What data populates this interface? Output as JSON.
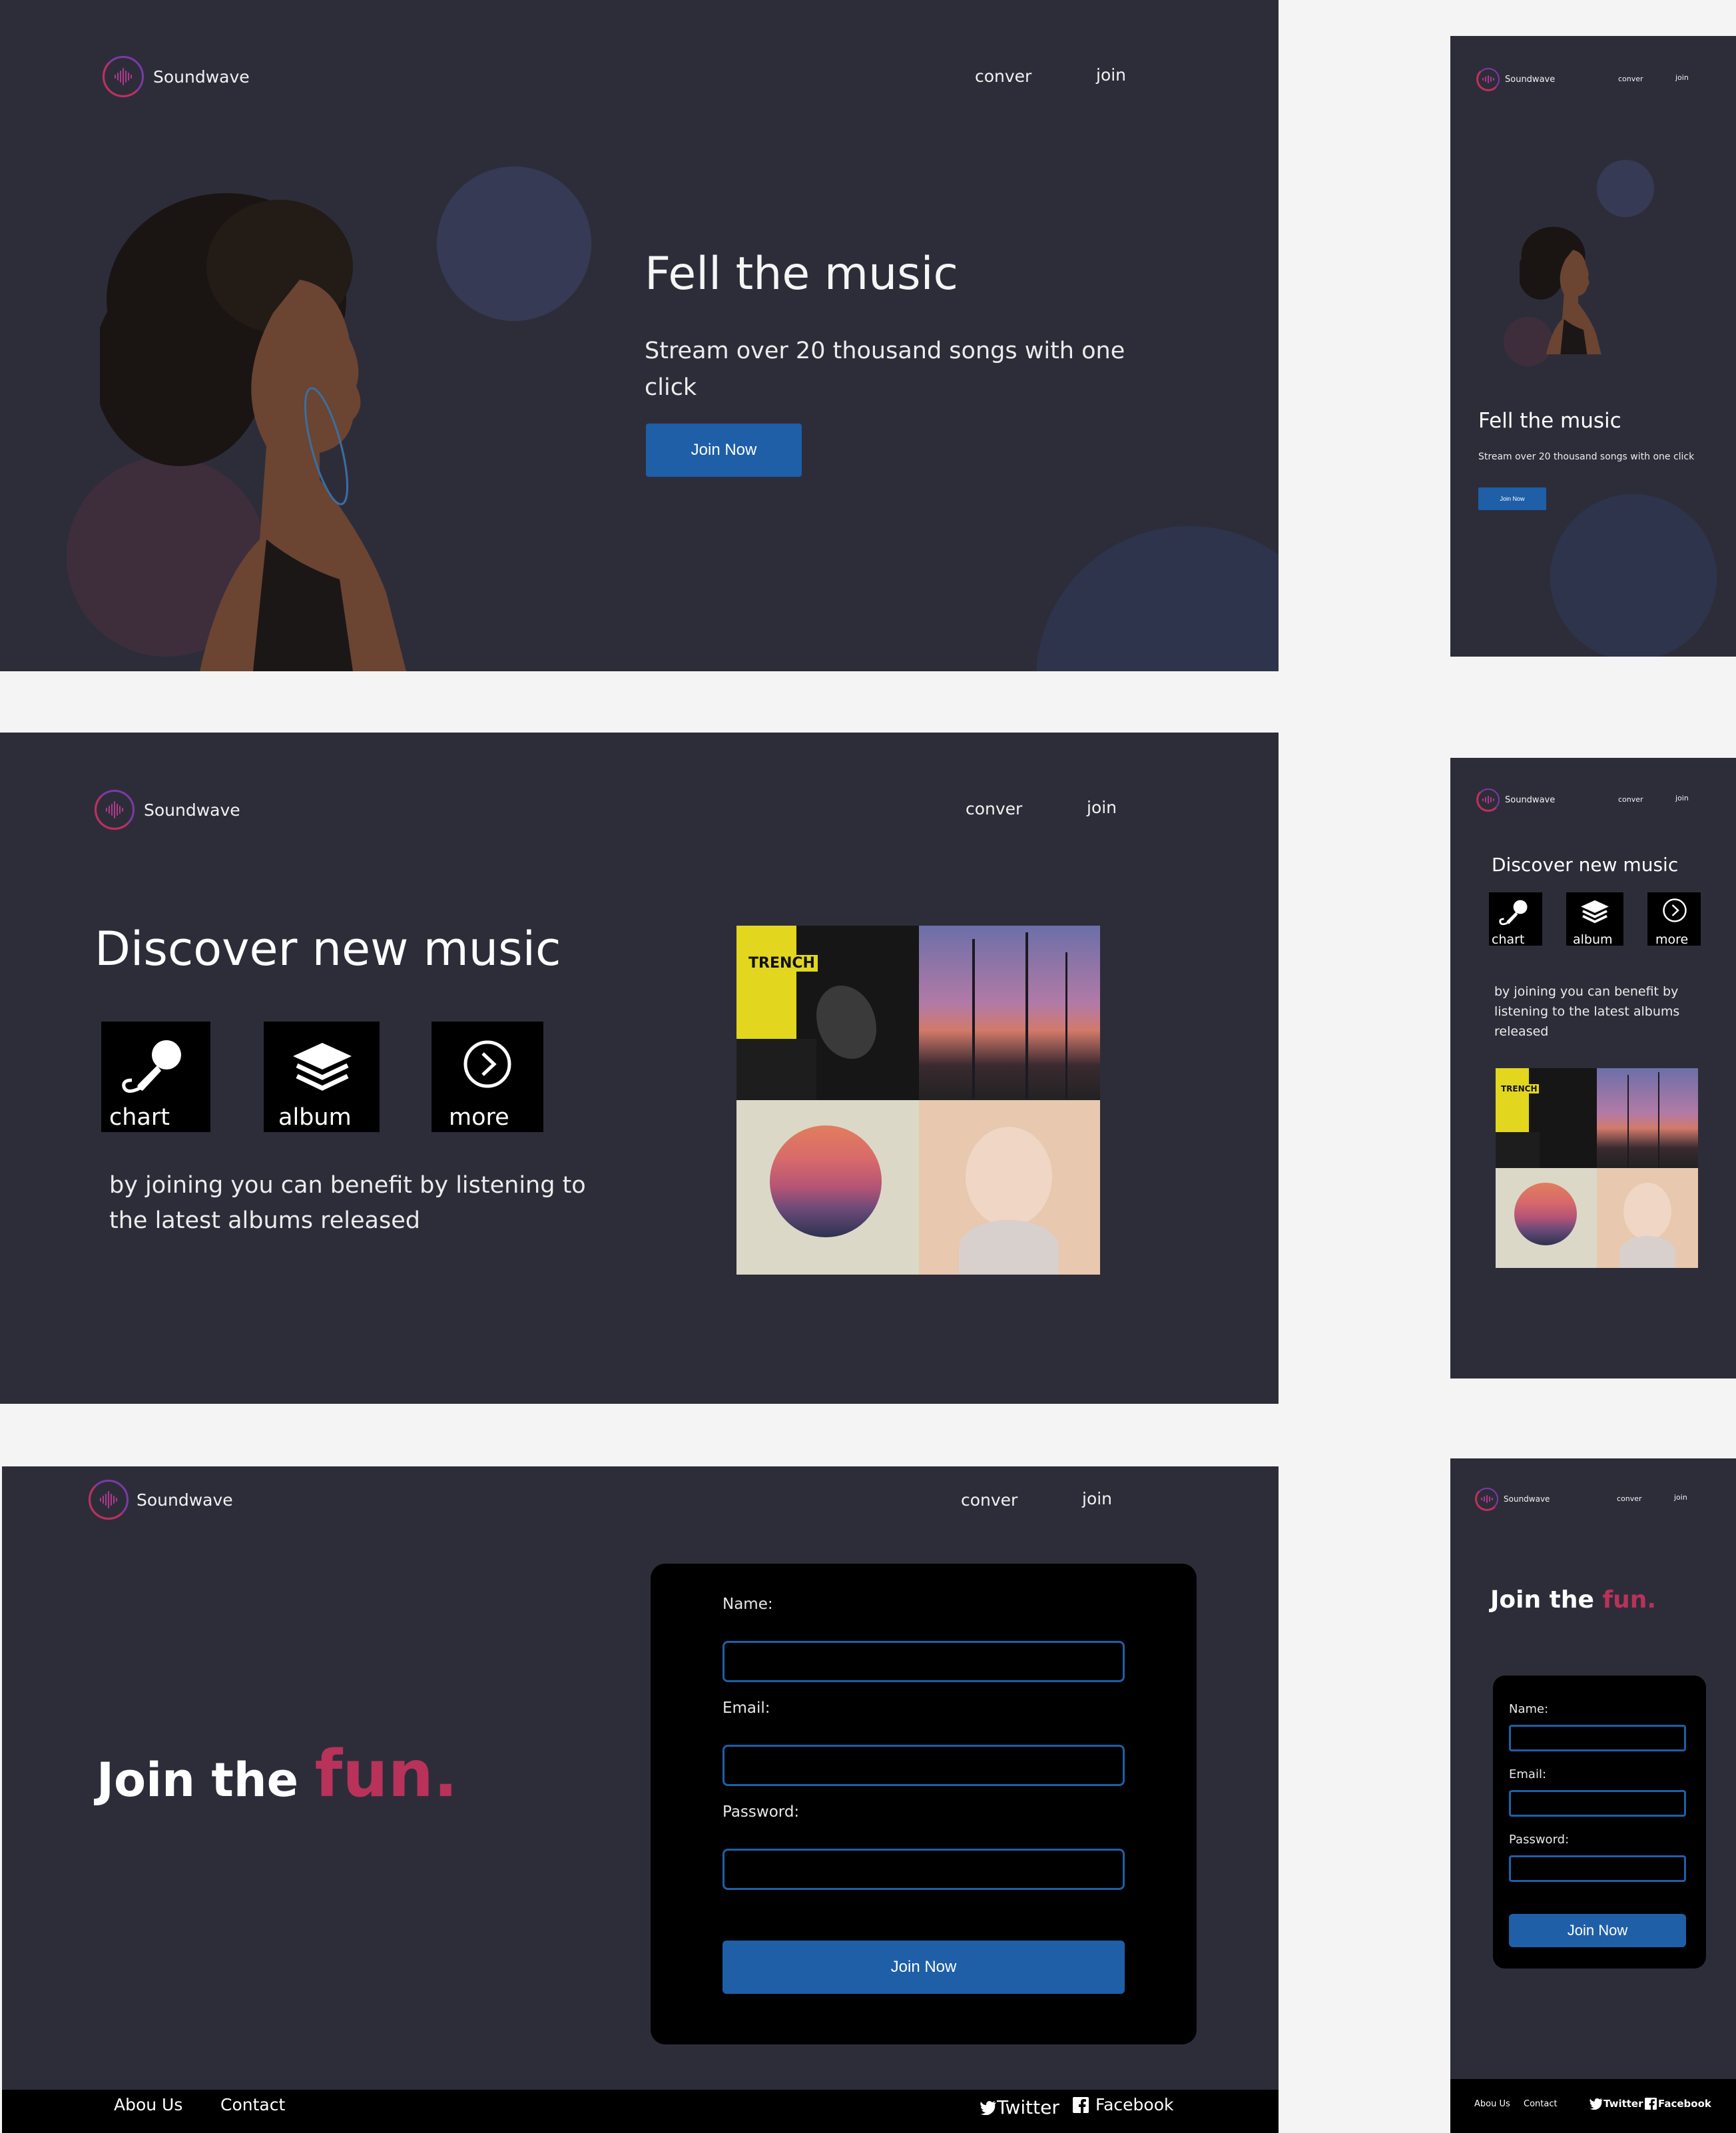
{
  "brand": {
    "name": "Soundwave"
  },
  "nav": {
    "link1": "conver",
    "link2": "join"
  },
  "hero": {
    "title": "Fell the music",
    "subtitle": "Stream over 20 thousand songs with one click",
    "cta": "Join Now"
  },
  "discover": {
    "title": "Discover new music",
    "tiles": [
      {
        "label": "chart",
        "icon": "microphone-icon"
      },
      {
        "label": "album",
        "icon": "layers-icon"
      },
      {
        "label": "more",
        "icon": "chevron-right-circle-icon"
      }
    ],
    "text": "by joining you can benefit by listening to the latest albums released",
    "albums": [
      {
        "name": "trench-album-cover",
        "cover_text": "TRENCH"
      },
      {
        "name": "palm-trees-album-cover"
      },
      {
        "name": "sunset-album-cover"
      },
      {
        "name": "portrait-album-cover"
      }
    ]
  },
  "join": {
    "title_start": "Join the",
    "title_accent": "fun.",
    "fields": [
      {
        "label": "Name:"
      },
      {
        "label": "Email:"
      },
      {
        "label": "Password:"
      }
    ],
    "submit": "Join Now"
  },
  "footer": {
    "about": "Abou Us",
    "contact": "Contact",
    "twitter": "Twitter",
    "facebook": "Facebook"
  },
  "colors": {
    "background": "#f4f4f4",
    "panel": "#2d2d3a",
    "accent_blue": "#1e5fa8",
    "accent_pink": "#b8325a",
    "tile": "#000000"
  }
}
